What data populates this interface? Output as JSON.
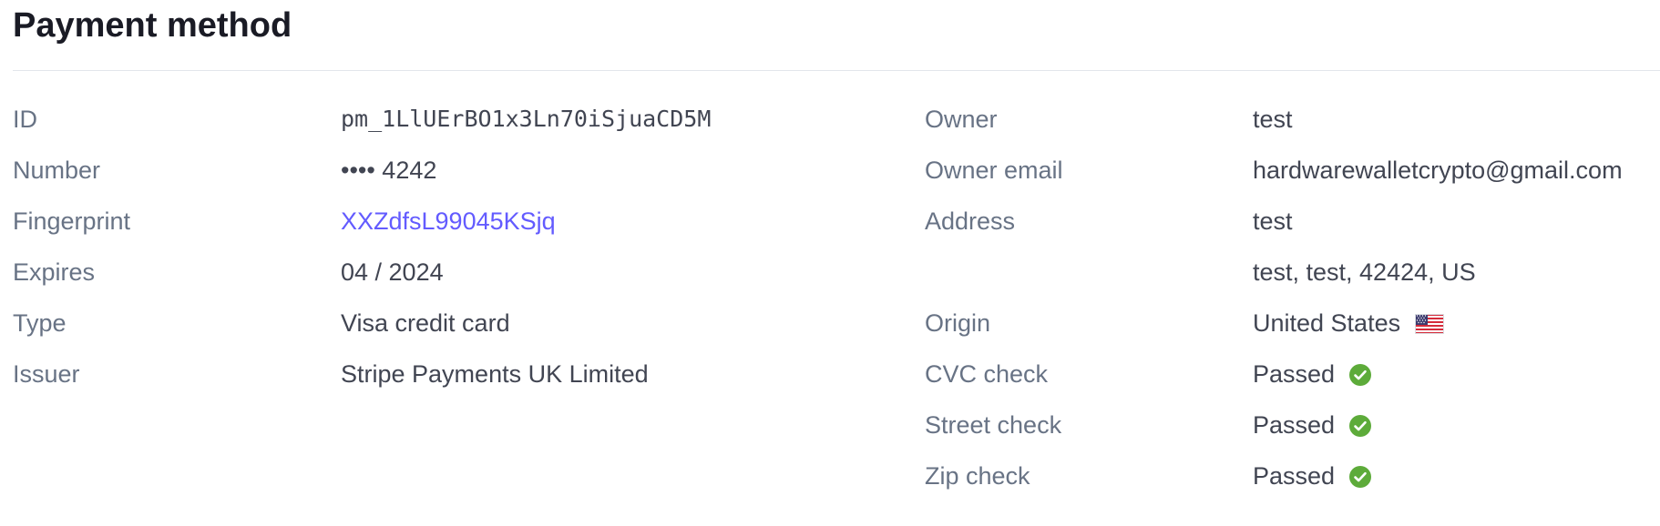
{
  "title": "Payment method",
  "left": [
    {
      "label": "ID",
      "value": "pm_1LlUErBO1x3Ln70iSjuaCD5M"
    },
    {
      "label": "Number",
      "value": "•••• 4242"
    },
    {
      "label": "Fingerprint",
      "value": "XXZdfsL99045KSjq"
    },
    {
      "label": "Expires",
      "value": "04 / 2024"
    },
    {
      "label": "Type",
      "value": "Visa credit card"
    },
    {
      "label": "Issuer",
      "value": "Stripe Payments UK Limited"
    }
  ],
  "right": {
    "owner": {
      "label": "Owner",
      "value": "test"
    },
    "owner_email": {
      "label": "Owner email",
      "value": "hardwarewalletcrypto@gmail.com"
    },
    "address": {
      "label": "Address",
      "line1": "test",
      "line2": "test, test, 42424, US"
    },
    "origin": {
      "label": "Origin",
      "value": "United States",
      "icon": "us-flag-icon"
    },
    "cvc_check": {
      "label": "CVC check",
      "value": "Passed",
      "icon": "check-circle-icon"
    },
    "street_check": {
      "label": "Street check",
      "value": "Passed",
      "icon": "check-circle-icon"
    },
    "zip_check": {
      "label": "Zip check",
      "value": "Passed",
      "icon": "check-circle-icon"
    }
  },
  "colors": {
    "link": "#635bff",
    "success": "#5dab3a",
    "label": "#687385",
    "value": "#414552",
    "title": "#1a1b25"
  }
}
